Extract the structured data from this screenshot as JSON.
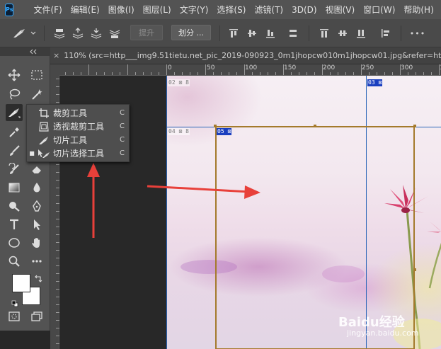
{
  "app": {
    "logo_text": "Ps"
  },
  "menu": [
    "文件(F)",
    "编辑(E)",
    "图像(I)",
    "图层(L)",
    "文字(Y)",
    "选择(S)",
    "滤镜(T)",
    "3D(D)",
    "视图(V)",
    "窗口(W)",
    "帮助(H)"
  ],
  "options_bar": {
    "tool_icon": "slice-tool-icon",
    "promote_label": "提升",
    "divide_label": "划分 ...",
    "more_label": "•••"
  },
  "document": {
    "tab_title": "110% (src=http___img9.51tietu.net_pic_2019-090923_0m1jhopcw010m1jhopcw01.jpg&refer=http___",
    "close_glyph": "×"
  },
  "ruler": {
    "top_labels": [
      "0",
      "50",
      "100",
      "150",
      "200",
      "250",
      "300",
      "350"
    ]
  },
  "toolbox": {
    "tools": [
      "move-icon",
      "marquee-icon",
      "lasso-icon",
      "magic-wand-icon",
      "slice-tool-icon",
      "eyedropper-icon",
      "brush-icon",
      "stamp-icon",
      "history-brush-icon",
      "eraser-icon",
      "gradient-icon",
      "blur-icon",
      "dodge-icon",
      "pen-icon",
      "type-icon",
      "path-select-icon",
      "ellipse-icon",
      "hand-icon",
      "zoom-icon",
      "more-tools-icon"
    ]
  },
  "flyout": {
    "items": [
      {
        "label": "裁剪工具",
        "shortcut": "C",
        "icon": "crop-icon",
        "selected": false
      },
      {
        "label": "透视裁剪工具",
        "shortcut": "C",
        "icon": "perspective-crop-icon",
        "selected": false
      },
      {
        "label": "切片工具",
        "shortcut": "C",
        "icon": "slice-icon",
        "selected": false
      },
      {
        "label": "切片选择工具",
        "shortcut": "C",
        "icon": "slice-select-icon",
        "selected": true
      }
    ]
  },
  "slices": [
    "02",
    "03",
    "04",
    "05"
  ],
  "colors": {
    "accent_arrow": "#e8403a",
    "slice_selection": "#a47a2c",
    "slice_line": "#2b66b8"
  },
  "watermark": {
    "logo": "Baidu经验",
    "sub": "jingyan.baidu.com"
  }
}
